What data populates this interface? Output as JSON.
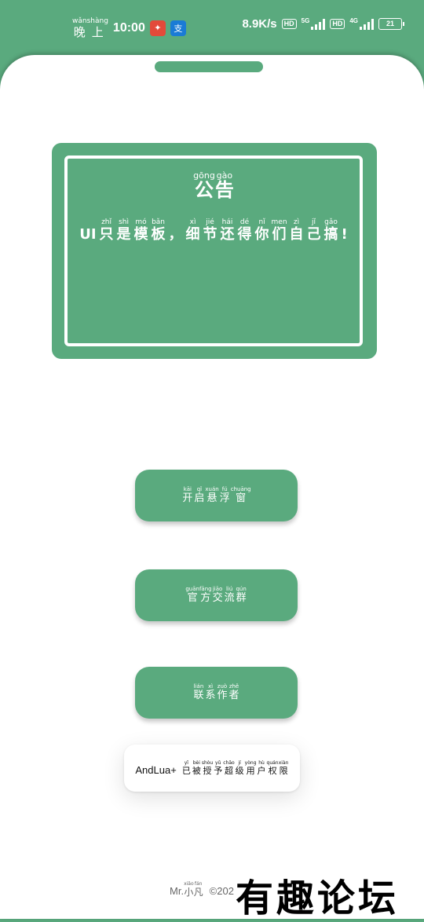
{
  "status_bar": {
    "time_prefix": "晚上",
    "time_prefix_pinyin": [
      "wǎn",
      "shàng"
    ],
    "time": "10:00",
    "speed": "8.9K/s",
    "hd1": "HD",
    "net1": "5G",
    "hd2": "HD",
    "net2": "4G",
    "battery": "21",
    "app_icons": [
      "red-app-icon",
      "alipay-icon"
    ]
  },
  "notice": {
    "title": [
      {
        "hz": "公",
        "py": "gōng"
      },
      {
        "hz": "告",
        "py": "gào"
      }
    ],
    "body": [
      {
        "hz": "UI",
        "py": ""
      },
      {
        "hz": "只",
        "py": "zhǐ"
      },
      {
        "hz": "是",
        "py": "shì"
      },
      {
        "hz": "模",
        "py": "mó"
      },
      {
        "hz": "板",
        "py": "bǎn"
      },
      {
        "hz": "，",
        "py": ""
      },
      {
        "hz": "细",
        "py": "xì"
      },
      {
        "hz": "节",
        "py": "jié"
      },
      {
        "hz": "还",
        "py": "hái"
      },
      {
        "hz": "得",
        "py": "dé"
      },
      {
        "hz": "你",
        "py": "nǐ"
      },
      {
        "hz": "们",
        "py": "men"
      },
      {
        "hz": "自",
        "py": "zì"
      },
      {
        "hz": "己",
        "py": "jǐ"
      },
      {
        "hz": "搞",
        "py": "gǎo"
      },
      {
        "hz": "!",
        "py": ""
      }
    ]
  },
  "buttons": {
    "float_window": [
      {
        "hz": "开",
        "py": "kāi"
      },
      {
        "hz": "启",
        "py": "qǐ"
      },
      {
        "hz": "悬",
        "py": "xuán"
      },
      {
        "hz": "浮",
        "py": "fú"
      },
      {
        "hz": "窗",
        "py": "chuāng"
      }
    ],
    "official_group": [
      {
        "hz": "官",
        "py": "guān"
      },
      {
        "hz": "方",
        "py": "fāng"
      },
      {
        "hz": "交",
        "py": "jiāo"
      },
      {
        "hz": "流",
        "py": "liú"
      },
      {
        "hz": "群",
        "py": "qún"
      }
    ],
    "contact_author": [
      {
        "hz": "联",
        "py": "lián"
      },
      {
        "hz": "系",
        "py": "xì"
      },
      {
        "hz": "作",
        "py": "zuò"
      },
      {
        "hz": "者",
        "py": "zhě"
      }
    ]
  },
  "permission": {
    "lead": "AndLua+",
    "text": [
      {
        "hz": "已",
        "py": "yǐ"
      },
      {
        "hz": "被",
        "py": "bèi"
      },
      {
        "hz": "授",
        "py": "shòu"
      },
      {
        "hz": "予",
        "py": "yǔ"
      },
      {
        "hz": "超",
        "py": "chāo"
      },
      {
        "hz": "级",
        "py": "jí"
      },
      {
        "hz": "用",
        "py": "yòng"
      },
      {
        "hz": "户",
        "py": "hù"
      },
      {
        "hz": "权",
        "py": "quán"
      },
      {
        "hz": "限",
        "py": "xiàn"
      }
    ]
  },
  "footer": {
    "prefix": "Mr.",
    "name": [
      {
        "hz": "小",
        "py": "xiǎo"
      },
      {
        "hz": "凡",
        "py": "fán"
      }
    ],
    "copyright": "©202"
  },
  "watermark": "有趣论坛",
  "colors": {
    "accent": "#5aaa7e",
    "background": "#ffffff"
  }
}
